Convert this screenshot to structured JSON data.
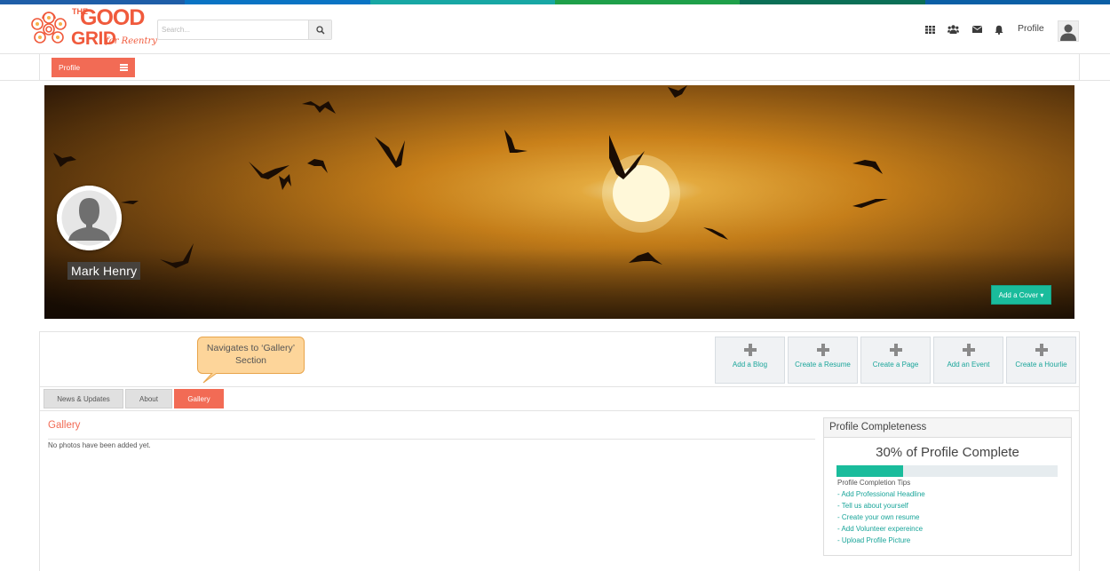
{
  "colors": {
    "accent_orange": "#f26b55",
    "accent_teal": "#1abc9c",
    "stripe": [
      "#1f5ea8",
      "#0a74c4",
      "#18a7a4",
      "#1fa04a",
      "#0b6f56",
      "#0b5fa6"
    ]
  },
  "header": {
    "logo": {
      "line1": "THE",
      "line2": "GOOD",
      "line3": "GRID",
      "tagline": "for Reentry"
    },
    "search": {
      "placeholder": "Search...",
      "button_icon": "search-icon"
    },
    "icons": [
      "apps-grid-icon",
      "users-icon",
      "mail-icon",
      "bell-icon"
    ],
    "profile_label": "Profile",
    "avatar_icon": "user-avatar-icon"
  },
  "subnav": {
    "profile_button": "Profile",
    "menu_icon": "hamburger-icon"
  },
  "cover": {
    "user_name": "Mark Henry",
    "add_cover": "Add a Cover ▾"
  },
  "callout": {
    "text": "Navigates to ‘Gallery’ Section"
  },
  "actions": [
    {
      "label": "Add a Blog",
      "icon": "plus-icon"
    },
    {
      "label": "Create a Resume",
      "icon": "plus-icon"
    },
    {
      "label": "Create a Page",
      "icon": "plus-icon"
    },
    {
      "label": "Add an Event",
      "icon": "plus-icon"
    },
    {
      "label": "Create a Hourlie",
      "icon": "plus-icon"
    }
  ],
  "tabs": [
    {
      "label": "News & Updates",
      "active": false
    },
    {
      "label": "About",
      "active": false
    },
    {
      "label": "Gallery",
      "active": true
    }
  ],
  "gallery": {
    "title": "Gallery",
    "empty_message": "No photos have been added yet."
  },
  "profile_completeness": {
    "title": "Profile Completeness",
    "percent_text": "30% of Profile Complete",
    "percent": 30,
    "tips_title": "Profile Completion Tips",
    "tips": [
      "- Add Professional Headline",
      "- Tell us about yourself",
      "- Create your own resume",
      "- Add Volunteer expereince",
      "- Upload Profile Picture"
    ]
  }
}
